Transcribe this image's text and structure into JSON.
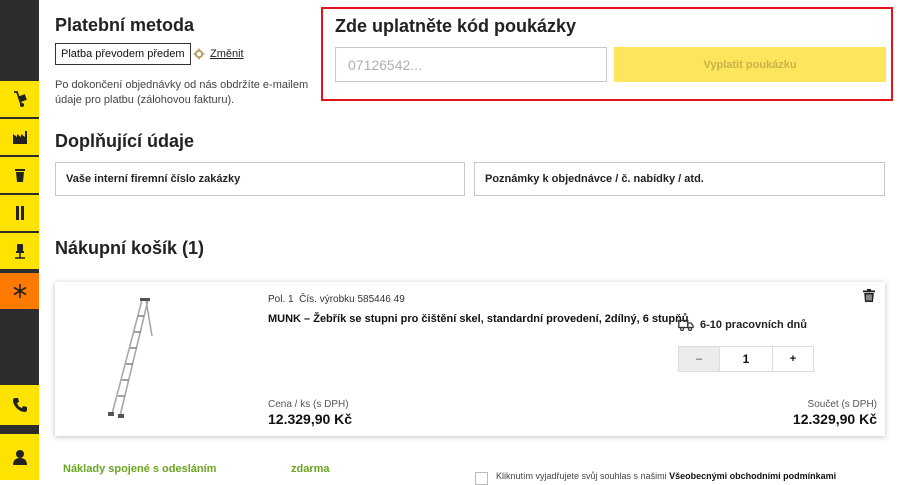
{
  "payment": {
    "title": "Platební metoda",
    "method": "Platba převodem předem",
    "change_label": "Změnit",
    "description": "Po dokončení objednávky od nás obdržíte e-mailem údaje pro platbu (zálohovou fakturu)."
  },
  "voucher": {
    "title": "Zde uplatněte kód poukázky",
    "placeholder": "07126542...",
    "button_label": "Vyplatit poukázku"
  },
  "additional": {
    "title": "Doplňující údaje",
    "internal_number_label": "Vaše interní firemní číslo zakázky",
    "notes_label": "Poznámky k objednávce / č. nabídky / atd."
  },
  "cart": {
    "title": "Nákupní košík (1)",
    "item": {
      "position": "Pol. 1",
      "product_number": "Čís. výrobku 585446 49",
      "name": "MUNK – Žebřík se stupni pro čištění skel, standardní provedení, 2dílný, 6 stupňů",
      "delivery": "6-10 pracovních dnů",
      "quantity": "1",
      "minus": "–",
      "plus": "+",
      "unit_price_label": "Cena / ks (s DPH)",
      "unit_price": "12.329,90 Kč",
      "total_label": "Součet (s DPH)",
      "total": "12.329,90 Kč"
    }
  },
  "shipping": {
    "label": "Náklady spojené s odesláním",
    "value": "zdarma"
  },
  "terms": {
    "text": "Kliknutím vyjadřujete svůj souhlas s našimi",
    "link": "Všeobecnými obchodními podmínkami"
  },
  "colors": {
    "brand_yellow": "#ffe300",
    "orange": "#ff7a00",
    "sidebar": "#2d2d2d",
    "highlight_red": "#e3141e",
    "shipping_green": "#6aa51e"
  },
  "sidebar_icons": [
    "hand-truck-icon",
    "factory-icon",
    "trash-bin-icon",
    "locker-icon",
    "office-chair-icon",
    "snowflake-icon",
    "phone-icon",
    "user-icon"
  ]
}
